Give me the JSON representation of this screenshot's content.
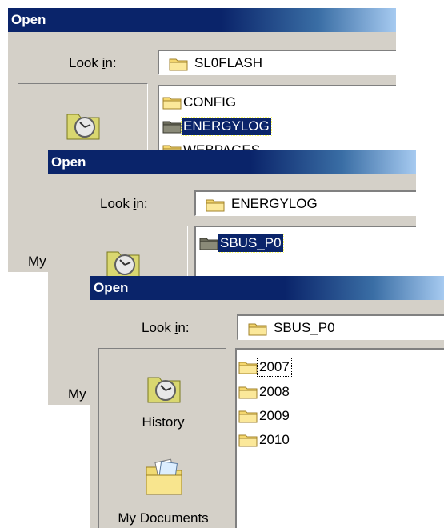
{
  "dialogs": [
    {
      "title": "Open",
      "look_in_label": "Look in:",
      "look_in_value": "SL0FLASH",
      "files": [
        "CONFIG",
        "ENERGYLOG",
        "WEBPAGES"
      ],
      "selected": "ENERGYLOG",
      "partial_place_label": "My"
    },
    {
      "title": "Open",
      "look_in_label": "Look in:",
      "look_in_value": "ENERGYLOG",
      "files": [
        "SBUS_P0"
      ],
      "selected": "SBUS_P0",
      "partial_place_label": "My"
    },
    {
      "title": "Open",
      "look_in_label": "Look in:",
      "look_in_value": "SBUS_P0",
      "files": [
        "2007",
        "2008",
        "2009",
        "2010"
      ],
      "focused": "2007",
      "places": [
        "History",
        "My Documents"
      ]
    }
  ],
  "icons": {
    "folder": "folder-icon",
    "history": "history-icon",
    "my_documents": "my-documents-icon"
  }
}
